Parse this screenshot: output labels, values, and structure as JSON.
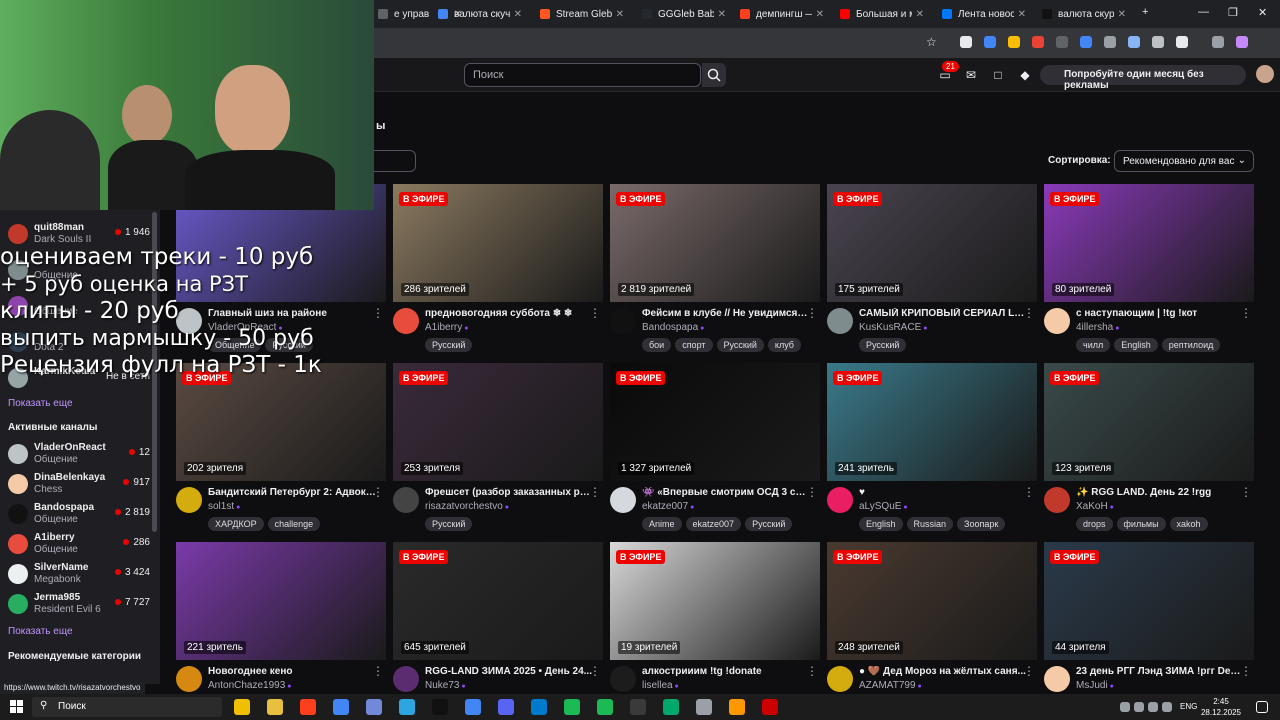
{
  "browser": {
    "tabs": [
      {
        "title": "е управ",
        "color": "#5f6368"
      },
      {
        "title": "валюта скучае",
        "color": "#4285f4"
      },
      {
        "title": "Stream Gleb Ba",
        "color": "#ff5722"
      },
      {
        "title": "GGGleb Babki",
        "color": "#24292f"
      },
      {
        "title": "демпингш — Я",
        "color": "#fc3f1d"
      },
      {
        "title": "Большая и ма",
        "color": "#ff0000"
      },
      {
        "title": "Лента новосте",
        "color": "#0077ff"
      },
      {
        "title": "валюта скурае",
        "color": "#111111"
      }
    ],
    "new_tab": "+",
    "status_url": "https://www.twitch.tv/risazatvorchestvo"
  },
  "twitch": {
    "search_placeholder": "Поиск",
    "notification_count": "21",
    "promo": "Попробуйте один месяц без рекламы",
    "heading_fragment": "ы",
    "sort_label": "Сортировка:",
    "sort_value": "Рекомендовано для вас"
  },
  "sidebar": {
    "top_channels": [
      {
        "name": "quit88man",
        "game": "Dark Souls II",
        "viewers": "1 946",
        "color": "#c0392b"
      },
      {
        "name": "",
        "game": "Общение",
        "viewers": "",
        "color": "#7f8c8d"
      },
      {
        "name": "",
        "game": "Общение",
        "viewers": "",
        "color": "#8e44ad"
      },
      {
        "name": "",
        "game": "Dota 2",
        "viewers": "",
        "color": "#2c3e50"
      },
      {
        "name": "KarmikKoala",
        "game": "",
        "viewers": "Не в сети",
        "color": "#95a5a6"
      }
    ],
    "show_more_1": "Показать еще",
    "active_heading": "Активные каналы",
    "active_channels": [
      {
        "name": "VladerOnReact",
        "game": "Общение",
        "viewers": "12",
        "color": "#bdc3c7"
      },
      {
        "name": "DinaBelenkaya",
        "game": "Chess",
        "viewers": "917",
        "color": "#f5cba7"
      },
      {
        "name": "Bandospapa",
        "game": "Общение",
        "viewers": "2 819",
        "color": "#111111"
      },
      {
        "name": "A1iberry",
        "game": "Общение",
        "viewers": "286",
        "color": "#e74c3c"
      },
      {
        "name": "SilverName",
        "game": "Megabonk",
        "viewers": "3 424",
        "color": "#ecf0f1"
      },
      {
        "name": "Jerma985",
        "game": "Resident Evil 6",
        "viewers": "7 727",
        "color": "#27ae60"
      }
    ],
    "show_more_2": "Показать еще",
    "recommended_heading": "Рекомендуемые категории"
  },
  "overlay": {
    "line1": "оцениваем треки - 10 руб",
    "line2": "+ 5 руб оценка на РЗТ",
    "line3": "клипы - 20 руб",
    "line4": "выпить мармышку - 50 руб",
    "line5": "Рецензия фулл на РЗТ - 1к"
  },
  "live_label": "В ЭФИРЕ",
  "cards": [
    {
      "viewers": "",
      "title": "Главный шиз на районе",
      "channel": "VladerOnReact",
      "tags": [
        "Общение",
        "Русский"
      ],
      "thumb": "#6a5acd",
      "avatar": "#bdc3c7",
      "live": false
    },
    {
      "viewers": "286 зрителей",
      "title": "предновогодняя суббота ❄ ❄",
      "channel": "A1iberry",
      "tags": [
        "Русский"
      ],
      "thumb": "#8b7a60",
      "avatar": "#e74c3c",
      "live": true
    },
    {
      "viewers": "2 819 зрителей",
      "title": "Фейсим в клубе // Не увидимся на...",
      "channel": "Bandospapa",
      "tags": [
        "бои",
        "спорт",
        "Русский",
        "клуб"
      ],
      "thumb": "#7a6a6a",
      "avatar": "#111111",
      "live": true
    },
    {
      "viewers": "175 зрителей",
      "title": "САМЫЙ КРИПОВЫЙ СЕРИАЛ LEXX",
      "channel": "KusKusRACE",
      "tags": [
        "Русский"
      ],
      "thumb": "#4a4450",
      "avatar": "#7f8c8d",
      "live": true
    },
    {
      "viewers": "80 зрителей",
      "title": "с наступающим | !tg !кот",
      "channel": "4illersha",
      "tags": [
        "чилл",
        "English",
        "рептилоид"
      ],
      "thumb": "#8a3ab9",
      "avatar": "#f5cba7",
      "live": true
    },
    {
      "viewers": "202 зрителя",
      "title": "Бандитский Петербург 2: Адвокат...",
      "channel": "sol1st",
      "tags": [
        "ХАРДКОР",
        "challenge"
      ],
      "thumb": "#5a4a42",
      "avatar": "#d4ac0d",
      "live": true
    },
    {
      "viewers": "253 зрителя",
      "title": "Фрешсет (разбор заказанных ре...",
      "channel": "risazatvorchestvo",
      "tags": [
        "Русский"
      ],
      "thumb": "#3a2a3a",
      "avatar": "#444444",
      "live": true
    },
    {
      "viewers": "1 327 зрителей",
      "title": "👾 «Впервые смотрим ОСД 3 сезо...",
      "channel": "ekatze007",
      "tags": [
        "Anime",
        "ekatze007",
        "Русский"
      ],
      "thumb": "#0a0a0a",
      "avatar": "#d5d8dc",
      "live": true
    },
    {
      "viewers": "241 зритель",
      "title": "♥",
      "channel": "aLySQuE",
      "tags": [
        "English",
        "Russian",
        "Зоопарк"
      ],
      "thumb": "#3a7a8a",
      "avatar": "#e91e63",
      "live": true
    },
    {
      "viewers": "123 зрителя",
      "title": "✨ RGG LAND. День 22 !rgg",
      "channel": "XaKoH",
      "tags": [
        "drops",
        "фильмы",
        "xakoh"
      ],
      "thumb": "#3a4a4a",
      "avatar": "#c0392b",
      "live": true
    },
    {
      "viewers": "221 зритель",
      "title": "Новогоднее кено",
      "channel": "AntonChaze1993",
      "tags": [],
      "thumb": "#7a3aa9",
      "avatar": "#d68910",
      "live": false
    },
    {
      "viewers": "645 зрителей",
      "title": "RGG-LAND ЗИМА 2025 • День 24...",
      "channel": "Nuke73",
      "tags": [],
      "thumb": "#2a2a2a",
      "avatar": "#5b2c6f",
      "live": true
    },
    {
      "viewers": "19 зрителей",
      "title": "алкострииим !tg !donate",
      "channel": "lisellea",
      "tags": [],
      "thumb": "#d8d8d8",
      "avatar": "#1c1c1c",
      "live": true
    },
    {
      "viewers": "248 зрителей",
      "title": "● 🤎 Дед Мороз на жёлтых саня...",
      "channel": "AZAMAT799",
      "tags": [],
      "thumb": "#4a3a30",
      "avatar": "#d4ac0d",
      "live": true
    },
    {
      "viewers": "44 зрителя",
      "title": "23 день РГГ Лэнд ЗИМА !ргг Dea...",
      "channel": "MsJudi",
      "tags": [],
      "thumb": "#2a3a4a",
      "avatar": "#f5cba7",
      "live": true
    }
  ],
  "taskbar": {
    "search": "Поиск",
    "lang": "ENG",
    "time": "2:45",
    "date": "28.12.2025"
  }
}
